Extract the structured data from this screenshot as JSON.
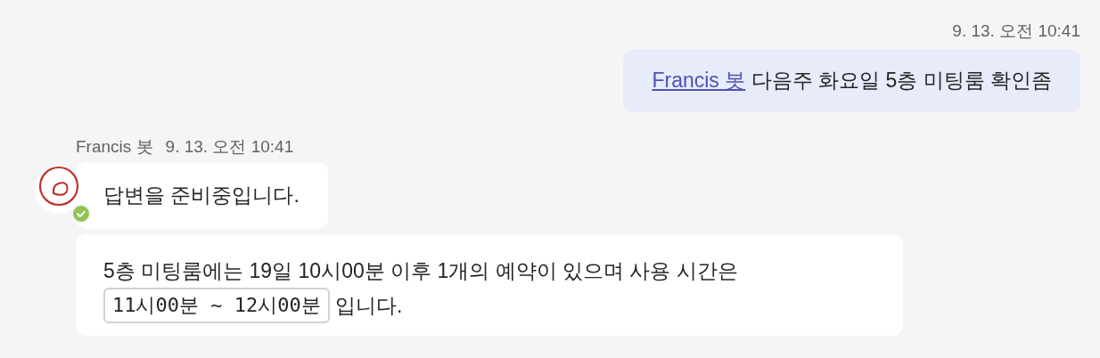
{
  "outgoing": {
    "time": "9. 13. 오전 10:41",
    "parts": [
      {
        "kind": "mention",
        "text": "Francis 봇"
      },
      {
        "kind": "text",
        "text": " 다음주 화요일 5층 미팅룸 확인좀"
      }
    ]
  },
  "incoming": {
    "sender": "Francis 봇",
    "time": "9. 13. 오전 10:41",
    "online": true,
    "messages": [
      {
        "lines": [
          [
            {
              "kind": "text",
              "text": "답변을 준비중입니다."
            }
          ]
        ]
      },
      {
        "lines": [
          [
            {
              "kind": "text",
              "text": "5층 미팅룸에는 19일 10시00분 이후 1개의 예약이 있으며 사용 시간은"
            }
          ],
          [
            {
              "kind": "code",
              "text": "11시00분 ~ 12시00분"
            },
            {
              "kind": "text",
              "text": " 입니다."
            }
          ]
        ]
      }
    ]
  }
}
